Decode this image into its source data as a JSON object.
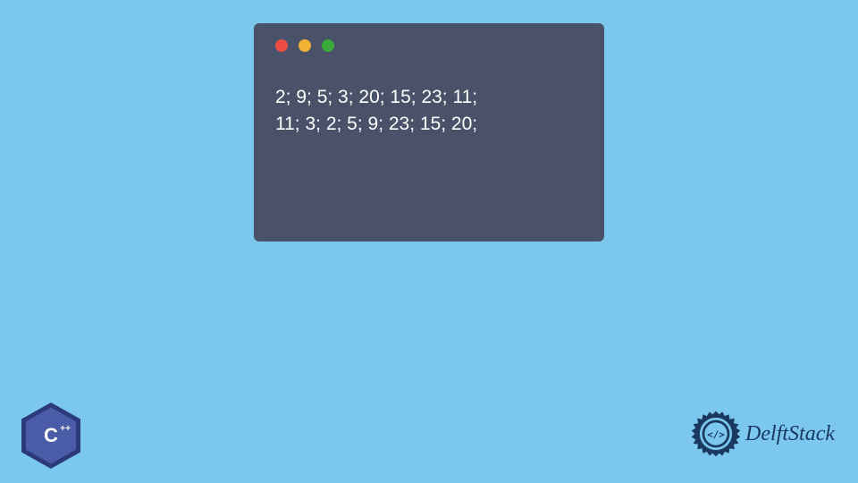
{
  "terminal": {
    "line1": "2; 9; 5; 3; 20; 15; 23; 11;",
    "line2": "11; 3; 2; 5; 9; 23; 15; 20;"
  },
  "cpp_badge": {
    "letter": "C",
    "plus": "++"
  },
  "brand": {
    "name": "DelftStack",
    "code_symbol": "</>"
  },
  "colors": {
    "background": "#7cc7ed",
    "terminal_bg": "#4a5269",
    "red_light": "#ed4c44",
    "yellow_light": "#f0b334",
    "green_light": "#3aab3a",
    "cpp_dark": "#2a3a7a",
    "cpp_light": "#4a5ba8",
    "brand_color": "#1a3960"
  }
}
